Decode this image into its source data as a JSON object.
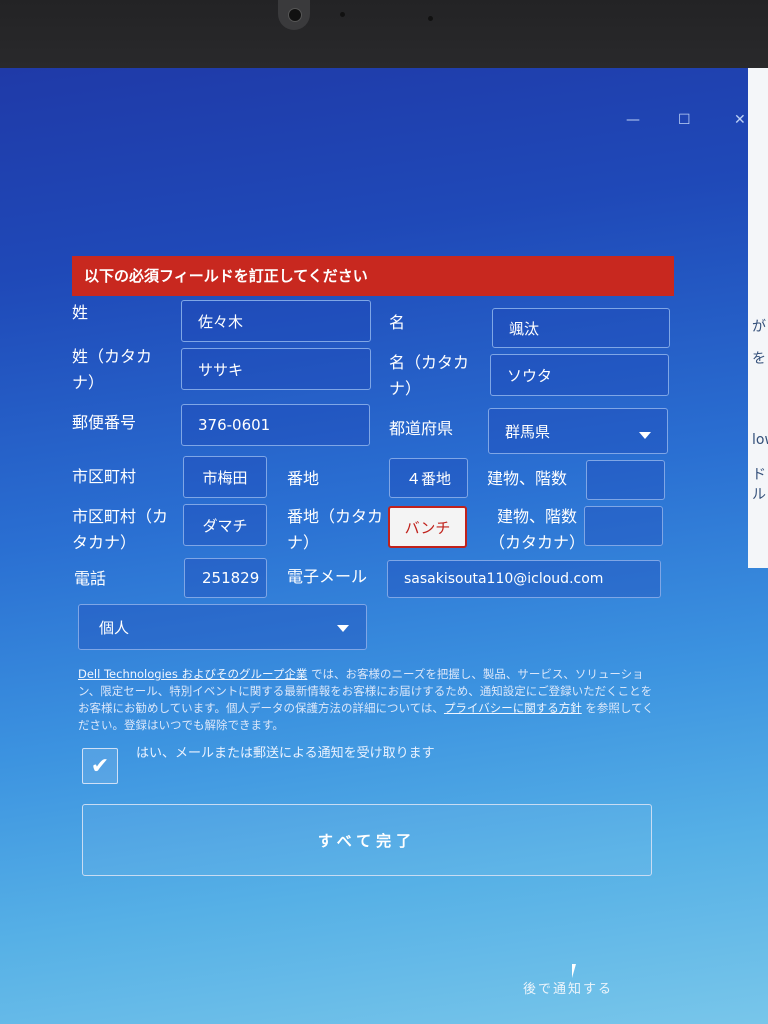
{
  "window": {
    "minimize_label": "—",
    "maximize_label": "☐",
    "close_label": "✕"
  },
  "side_text": [
    "が",
    "を",
    "low",
    "ドル"
  ],
  "form": {
    "error_banner": "以下の必須フィールドを訂正してください",
    "last_name_label": "姓",
    "last_name_value": "佐々木",
    "first_name_label": "名",
    "first_name_value": "颯汰",
    "last_name_kana_label": "姓（カタカナ）",
    "last_name_kana_value": "ササキ",
    "first_name_kana_label": "名（カタカナ）",
    "first_name_kana_value": "ソウタ",
    "postal_label": "郵便番号",
    "postal_value": "376-0601",
    "prefecture_label": "都道府県",
    "prefecture_value": "群馬県",
    "city_label": "市区町村",
    "city_value": "市梅田",
    "address_label": "番地",
    "address_value": "４番地",
    "building_label": "建物、階数",
    "building_value": "",
    "city_kana_label": "市区町村（カタカナ）",
    "city_kana_value": "ダマチ",
    "address_kana_label": "番地（カタカナ）",
    "address_kana_value": "バンチ",
    "building_kana_label": "建物、階数（カタカナ）",
    "building_kana_value": "",
    "phone_label": "電話",
    "phone_value": "251829",
    "email_label": "電子メール",
    "email_value": "sasakisouta110@icloud.com",
    "customer_type_value": "個人"
  },
  "legal": {
    "company_link": "Dell Technologies およびそのグループ企業",
    "text_1": " では、お客様のニーズを把握し、製品、サービス、ソリューション、限定セール、特別イベントに関する最新情報をお客様にお届けするため、通知設定にご登録いただくことをお客様にお勧めしています。個人データの保護方法の詳細については、",
    "privacy_link": "プライバシーに関する方針",
    "text_2": " を参照してください。登録はいつでも解除できます。"
  },
  "consent": {
    "checked": true,
    "label": "はい、メールまたは郵送による通知を受け取ります"
  },
  "buttons": {
    "submit": "すべて完了",
    "later": "後で通知する"
  },
  "colors": {
    "error_red": "#c8281f",
    "bg_top": "#1f3aa8",
    "bg_bottom": "#78c6ea"
  }
}
